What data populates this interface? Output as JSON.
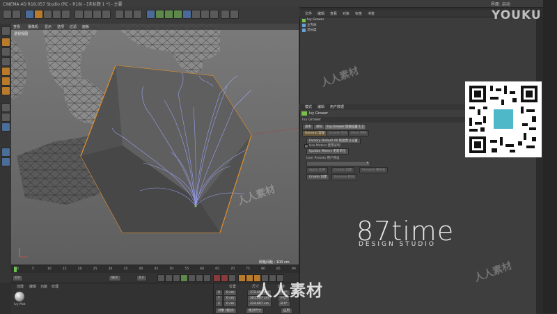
{
  "window": {
    "title": "CINEMA 4D R18.057 Studio (RC - R18) - [未标题 1 *] - 主要",
    "right_controls": "界面: 启动"
  },
  "viewport": {
    "menu": [
      "查看",
      "摄像机",
      "显示",
      "选项",
      "过滤",
      "面板"
    ],
    "label": "透视视图",
    "grid_spacing": "网格间距 : 100 cm"
  },
  "timeline": {
    "ticks": [
      "0",
      "5",
      "10",
      "15",
      "20",
      "25",
      "30",
      "35",
      "40",
      "45",
      "50",
      "55",
      "60",
      "65",
      "70",
      "75",
      "80",
      "85",
      "90"
    ],
    "start_frame": "0 F",
    "current_frame": "0 F",
    "end_frame": "90 F",
    "end_frame_2": "90 F"
  },
  "material_manager": {
    "menu": [
      "创建",
      "编辑",
      "功能",
      "纹理"
    ],
    "material_name": "Ivy Mat"
  },
  "coordinates": {
    "headers": [
      "位置",
      "尺寸",
      "旋转"
    ],
    "rows": [
      {
        "axis": "X",
        "pos": "0 cm",
        "size": "372.491 cm",
        "rot": "H 0°"
      },
      {
        "axis": "Y",
        "pos": "0 cm",
        "size": "301.107 cm",
        "rot": "P 0°"
      },
      {
        "axis": "Z",
        "pos": "0 cm",
        "size": "224.607 cm",
        "rot": "B 0°"
      }
    ],
    "mode": "对象 (相对)",
    "size_mode": "绝对尺寸",
    "apply_label": "应用"
  },
  "object_manager": {
    "menu": [
      "文件",
      "编辑",
      "查看",
      "对象",
      "标签",
      "书签"
    ],
    "objects": [
      {
        "name": "Ivy Grower",
        "color": "#7ac04a"
      },
      {
        "name": "立方体",
        "color": "#6aa0d8"
      },
      {
        "name": "灵长类",
        "color": "#6aa0d8"
      }
    ]
  },
  "attribute_manager": {
    "menu": [
      "模式",
      "编辑",
      "用户数据"
    ],
    "object_title": "Ivy Grower",
    "sub_title": "Ivy Grower",
    "tabs": [
      "基本",
      "坐标",
      "Ivy Grower 常规设置 1.1"
    ],
    "tabs2": [
      "General 常规",
      "Growth 生长",
      "Mesh 网格"
    ],
    "factory_button": "Factory Default All 恢复默认设置",
    "use_meters": "Use Meters 使用米制",
    "update_button": "Update Meters 更新单位",
    "user_presets_label": "User Presets 用户预设",
    "preset_value": "",
    "preset_buttons": [
      "Apply 应用",
      "Create 创建",
      "Rename 重命名"
    ],
    "preset_buttons2": [
      "Create 创建",
      "Remove 移除"
    ]
  },
  "watermarks": {
    "brand_main": "87time",
    "brand_sub": "DESIGN STUDIO",
    "youku": "YOUKU",
    "rrsc": "人人素材",
    "faint": [
      "人人素材",
      "人人素材",
      "人人素材"
    ]
  },
  "colors": {
    "ivy": "#9fa8ff",
    "cube": "#5c5c5c",
    "selection": "#e0902c",
    "qr_center": "#4fb8c8"
  }
}
